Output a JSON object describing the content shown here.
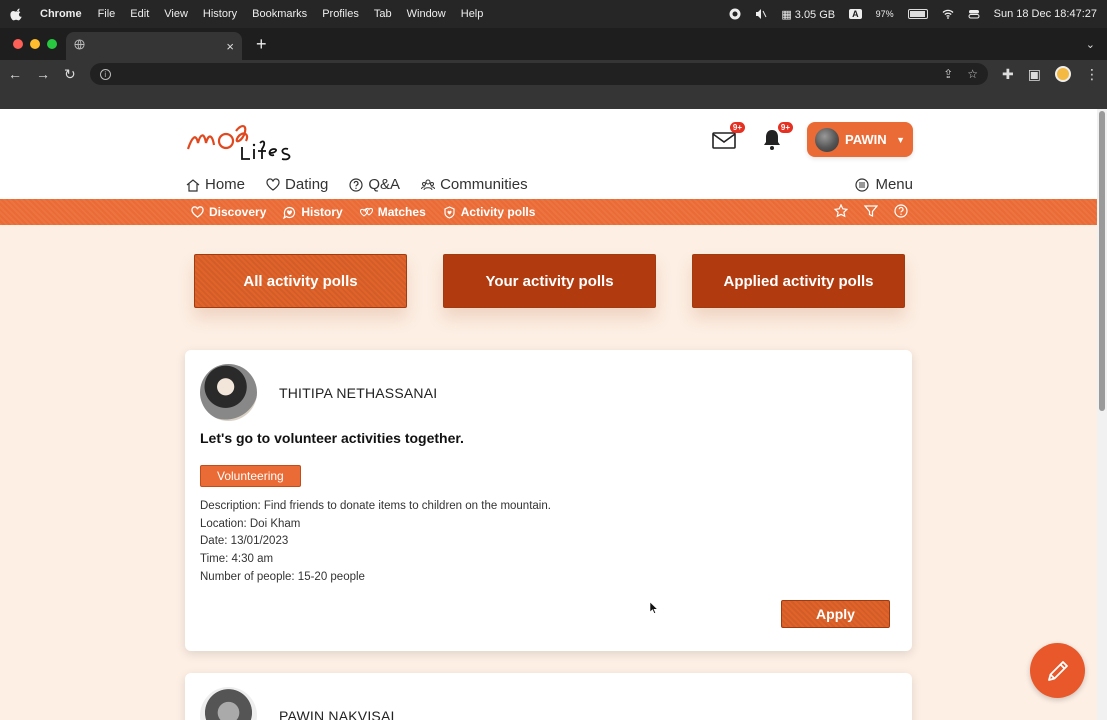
{
  "menubar": {
    "app": "Chrome",
    "items": [
      "File",
      "Edit",
      "View",
      "History",
      "Bookmarks",
      "Profiles",
      "Tab",
      "Window",
      "Help"
    ],
    "memory": "3.05 GB",
    "input_badge": "A",
    "battery": "97%",
    "datetime": "Sun 18 Dec 18:47:27"
  },
  "browser": {
    "tab_close": "×",
    "new_tab": "+"
  },
  "site": {
    "logo_text": "MooLifes",
    "mail_count": "9+",
    "notif_count": "9+",
    "user_name": "PAWIN",
    "nav": [
      "Home",
      "Dating",
      "Q&A",
      "Communities"
    ],
    "menu_label": "Menu",
    "subnav": [
      "Discovery",
      "History",
      "Matches",
      "Activity polls"
    ],
    "poll_buttons": [
      "All activity polls",
      "Your activity polls",
      "Applied activity polls"
    ]
  },
  "posts": [
    {
      "author": "THITIPA NETHASSANAI",
      "title": "Let's go to volunteer activities together.",
      "tag": "Volunteering",
      "description": "Description: Find friends to donate items to children on the mountain.",
      "location": "Location: Doi Kham",
      "date": "Date: 13/01/2023",
      "time": "Time: 4:30 am",
      "people": "Number of people: 15-20 people",
      "apply_label": "Apply"
    },
    {
      "author": "PAWIN NAKVISAI"
    }
  ],
  "colors": {
    "accent": "#ea6b35",
    "accent_dark": "#b13a0e",
    "page_bg": "#fdefe4"
  }
}
